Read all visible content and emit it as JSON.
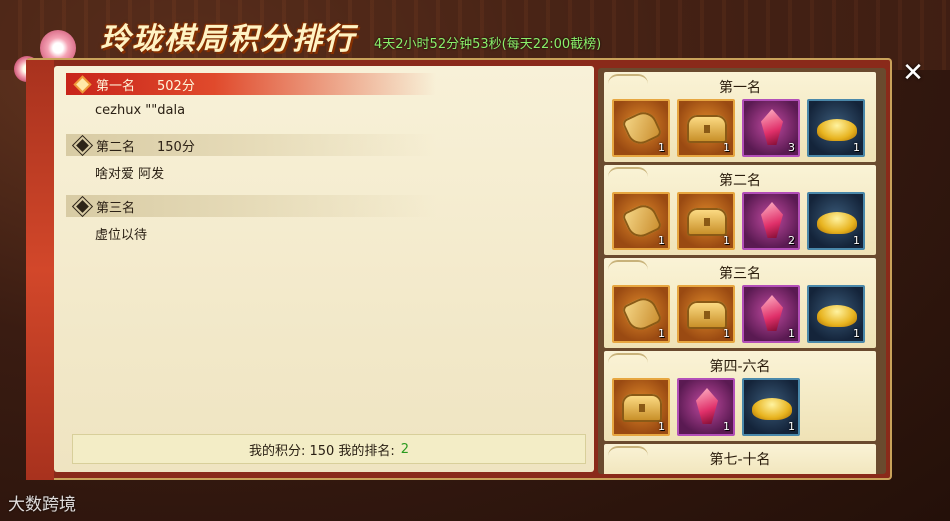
{
  "header": {
    "title": "玲珑棋局积分排行",
    "countdown": "4天2小时52分钟53秒(每天22:00截榜)"
  },
  "ranking": {
    "rows": [
      {
        "label": "第一名",
        "score": "502分",
        "members": "cezhux  \"\"dala"
      },
      {
        "label": "第二名",
        "score": "150分",
        "members": "啥对爱  阿发"
      },
      {
        "label": "第三名",
        "score": "",
        "members": "虚位以待"
      }
    ],
    "my_score_label": "我的积分: 150 我的排名:",
    "my_rank": "2"
  },
  "rewards": {
    "tiers": [
      {
        "title": "第一名",
        "items": [
          {
            "icon": "scroll-icon",
            "qty": "1",
            "frame": "orange"
          },
          {
            "icon": "treasure-chest-icon",
            "qty": "1",
            "frame": "orange"
          },
          {
            "icon": "crystal-icon",
            "qty": "3",
            "frame": "purple"
          },
          {
            "icon": "gold-ingot-icon",
            "qty": "1",
            "frame": "blue"
          }
        ]
      },
      {
        "title": "第二名",
        "items": [
          {
            "icon": "scroll-icon",
            "qty": "1",
            "frame": "orange"
          },
          {
            "icon": "treasure-chest-icon",
            "qty": "1",
            "frame": "orange"
          },
          {
            "icon": "crystal-icon",
            "qty": "2",
            "frame": "purple"
          },
          {
            "icon": "gold-ingot-icon",
            "qty": "1",
            "frame": "blue"
          }
        ]
      },
      {
        "title": "第三名",
        "items": [
          {
            "icon": "scroll-icon",
            "qty": "1",
            "frame": "orange"
          },
          {
            "icon": "treasure-chest-icon",
            "qty": "1",
            "frame": "orange"
          },
          {
            "icon": "crystal-icon",
            "qty": "1",
            "frame": "purple"
          },
          {
            "icon": "gold-ingot-icon",
            "qty": "1",
            "frame": "blue"
          }
        ]
      },
      {
        "title": "第四-六名",
        "items": [
          {
            "icon": "treasure-chest-icon",
            "qty": "1",
            "frame": "orange"
          },
          {
            "icon": "crystal-icon",
            "qty": "1",
            "frame": "purple"
          },
          {
            "icon": "gold-ingot-icon",
            "qty": "1",
            "frame": "blue"
          }
        ]
      },
      {
        "title": "第七-十名",
        "items": []
      }
    ]
  },
  "watermark": "大数跨境",
  "close_glyph": "✕"
}
